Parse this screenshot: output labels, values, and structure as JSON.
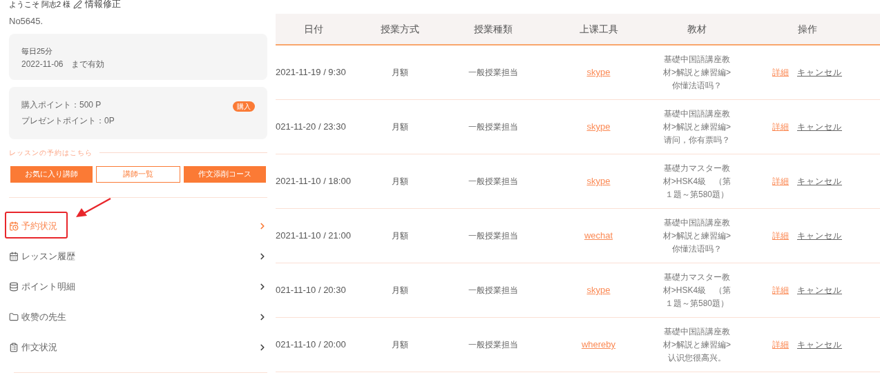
{
  "user": {
    "greeting": "ようこそ 阿志2 様",
    "edit_link": "情報修正",
    "member_no": "No5645."
  },
  "plan_card": {
    "plan": "毎日25分",
    "validity": "2022-11-06　まで有効"
  },
  "points_card": {
    "purchased": "購入ポイント：500 P",
    "present": "プレゼントポイント：0P",
    "buy_button": "購入"
  },
  "booking": {
    "label": "レッスンの予約はこちら",
    "buttons": [
      {
        "label": "お気に入り講師",
        "kind": "filled"
      },
      {
        "label": "講師一覧",
        "kind": "outline"
      },
      {
        "label": "作文添削コース",
        "kind": "filled"
      }
    ]
  },
  "menu": [
    {
      "label": "予約状況",
      "kind": "calendar",
      "selected": true,
      "annotated": true
    },
    {
      "label": "レッスン履歴",
      "kind": "history",
      "selected": false,
      "annotated": false
    },
    {
      "label": "ポイント明細",
      "kind": "coins",
      "selected": false,
      "annotated": false
    },
    {
      "label": "收赞の先生",
      "kind": "folder",
      "selected": false,
      "annotated": false
    },
    {
      "label": "作文状況",
      "kind": "document",
      "selected": false,
      "annotated": false
    }
  ],
  "table": {
    "columns": [
      "日付",
      "授業方式",
      "授業種類",
      "上课工具",
      "教材",
      "操作"
    ],
    "rows": [
      {
        "date": "2021-11-19 / 9:30",
        "method": "月額",
        "type": "一般授業担当",
        "tool": "skype",
        "material_lines": [
          "基礎中国語講座教",
          "材>解説と練習編>",
          "你懂法语吗？"
        ],
        "actions": [
          "詳細",
          "キャンセル"
        ]
      },
      {
        "date": "021-11-20 / 23:30",
        "method": "月額",
        "type": "一般授業担当",
        "tool": "skype",
        "material_lines": [
          "基礎中国語講座教",
          "材>解説と練習編>",
          "请问，你有票吗？"
        ],
        "actions": [
          "詳細",
          "キャンセル"
        ]
      },
      {
        "date": "2021-11-10 / 18:00",
        "method": "月額",
        "type": "一般授業担当",
        "tool": "skype",
        "material_lines": [
          "基礎力マスター教",
          "材>HSK4級　（第",
          "１題～第580題）"
        ],
        "actions": [
          "詳細",
          "キャンセル"
        ]
      },
      {
        "date": "2021-11-10 / 21:00",
        "method": "月額",
        "type": "一般授業担当",
        "tool": "wechat",
        "material_lines": [
          "基礎中国語講座教",
          "材>解説と練習編>",
          "你懂法语吗？"
        ],
        "actions": [
          "詳細",
          "キャンセル"
        ]
      },
      {
        "date": "021-11-10 / 20:30",
        "method": "月額",
        "type": "一般授業担当",
        "tool": "skype",
        "material_lines": [
          "基礎力マスター教",
          "材>HSK4級　（第",
          "１題～第580題）"
        ],
        "actions": [
          "詳細",
          "キャンセル"
        ]
      },
      {
        "date": "021-11-10 / 20:00",
        "method": "月額",
        "type": "一般授業担当",
        "tool": "whereby",
        "material_lines": [
          "基礎中国語講座教",
          "材>解説と練習編>",
          "认识您很高兴。"
        ],
        "actions": [
          "詳細",
          "キャンセル"
        ]
      }
    ]
  }
}
